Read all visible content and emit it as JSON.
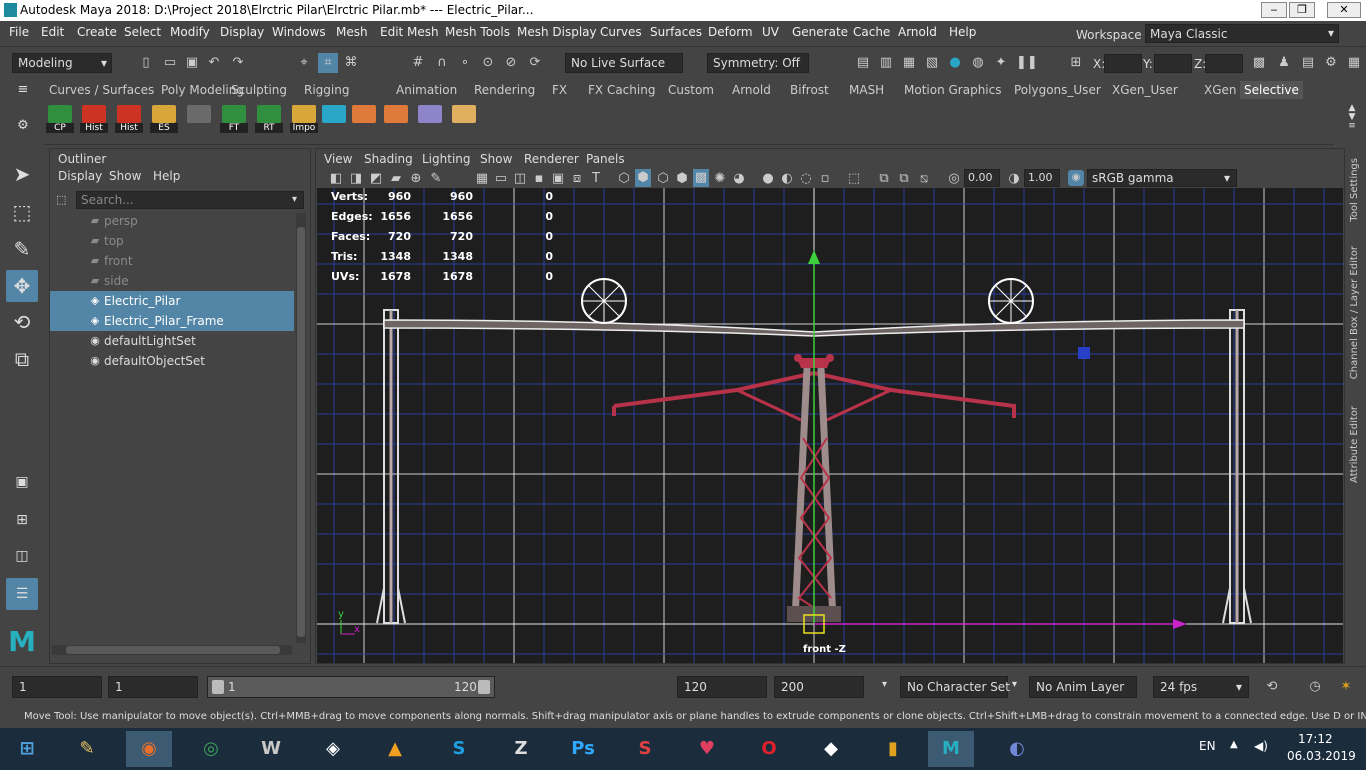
{
  "window": {
    "title": "Autodesk Maya 2018: D:\\Project 2018\\Elrctric Pilar\\Elrctric Pilar.mb*   ---   Electric_Pilar...",
    "minimize": "‒",
    "maximize": "❐",
    "close": "✕"
  },
  "menu": [
    "File",
    "Edit",
    "Create",
    "Select",
    "Modify",
    "Display",
    "Windows",
    "Mesh",
    "Edit Mesh",
    "Mesh Tools",
    "Mesh Display",
    "Curves",
    "Surfaces",
    "Deform",
    "UV",
    "Generate",
    "Cache",
    "Arnold",
    "Help"
  ],
  "workspace": {
    "label": "Workspace :",
    "value": "Maya Classic"
  },
  "status": {
    "mode": "Modeling",
    "live_surface": "No Live Surface",
    "symmetry": "Symmetry: Off",
    "x_label": "X:",
    "y_label": "Y:",
    "z_label": "Z:"
  },
  "shelf_tabs": [
    "Curves / Surfaces",
    "Poly Modeling",
    "Sculpting",
    "Rigging",
    "Animation",
    "Rendering",
    "FX",
    "FX Caching",
    "Custom",
    "Arnold",
    "Bifrost",
    "MASH",
    "Motion Graphics",
    "Polygons_User",
    "XGen_User",
    "XGen",
    "Selective"
  ],
  "shelf_active": "Selective",
  "shelf_buttons": [
    {
      "label": "CP",
      "color": "#2f8f3f"
    },
    {
      "label": "Hist",
      "color": "#cc3322"
    },
    {
      "label": "Hist",
      "color": "#cc3322"
    },
    {
      "label": "ES",
      "color": "#d9a63a"
    },
    {
      "label": "",
      "color": "#6a6a6a"
    },
    {
      "label": "FT",
      "color": "#2f8f3f"
    },
    {
      "label": "RT",
      "color": "#2f8f3f"
    },
    {
      "label": "Impo",
      "color": "#d9a63a"
    },
    {
      "label": "",
      "color": "#2aa6c9"
    },
    {
      "label": "",
      "color": "#e07a3a"
    },
    {
      "label": "",
      "color": "#e07a3a"
    },
    {
      "label": "",
      "color": "#8e84c9"
    },
    {
      "label": "",
      "color": "#e0b060"
    }
  ],
  "outliner": {
    "title": "Outliner",
    "menus": [
      "Display",
      "Show",
      "Help"
    ],
    "search_placeholder": "Search...",
    "items": [
      {
        "name": "persp",
        "icon": "camera-icon",
        "selected": false,
        "dim": true
      },
      {
        "name": "top",
        "icon": "camera-icon",
        "selected": false,
        "dim": true
      },
      {
        "name": "front",
        "icon": "camera-icon",
        "selected": false,
        "dim": true
      },
      {
        "name": "side",
        "icon": "camera-icon",
        "selected": false,
        "dim": true
      },
      {
        "name": "Electric_Pilar",
        "icon": "mesh-icon",
        "selected": true,
        "dim": false
      },
      {
        "name": "Electric_Pilar_Frame",
        "icon": "mesh-icon",
        "selected": true,
        "dim": false
      },
      {
        "name": "defaultLightSet",
        "icon": "set-icon",
        "selected": false,
        "dim": false
      },
      {
        "name": "defaultObjectSet",
        "icon": "set-icon",
        "selected": false,
        "dim": false
      }
    ]
  },
  "viewport": {
    "menus": [
      "View",
      "Shading",
      "Lighting",
      "Show",
      "Renderer",
      "Panels"
    ],
    "exposure": "0.00",
    "gamma": "1.00",
    "color_space": "sRGB gamma",
    "camera_label": "front -Z",
    "hud": [
      {
        "label": "Verts:",
        "a": "960",
        "b": "960",
        "c": "0"
      },
      {
        "label": "Edges:",
        "a": "1656",
        "b": "1656",
        "c": "0"
      },
      {
        "label": "Faces:",
        "a": "720",
        "b": "720",
        "c": "0"
      },
      {
        "label": "Tris:",
        "a": "1348",
        "b": "1348",
        "c": "0"
      },
      {
        "label": "UVs:",
        "a": "1678",
        "b": "1678",
        "c": "0"
      }
    ],
    "axis_y": "y",
    "axis_x": "x"
  },
  "side_tabs": [
    "Tool Settings",
    "Channel Box / Layer Editor",
    "Attribute Editor"
  ],
  "timeline": {
    "start": "1",
    "current": "1",
    "range_start": "1",
    "range_end": "120",
    "end": "120",
    "max": "200",
    "character_set": "No Character Set",
    "anim_layer": "No Anim Layer",
    "fps": "24 fps"
  },
  "helpline": "Move Tool: Use manipulator to move object(s). Ctrl+MMB+drag to move components along normals. Shift+drag manipulator axis or plane handles to extrude components or clone objects. Ctrl+Shift+LMB+drag to constrain movement to a connected edge. Use D or INSERT to change the pivot position a",
  "taskbar": {
    "lang": "EN",
    "time": "17:12",
    "date": "06.03.2019",
    "apps": [
      {
        "name": "start",
        "glyph": "⊞",
        "color": "#4fa3e0"
      },
      {
        "name": "paint",
        "glyph": "✎",
        "color": "#e8c060"
      },
      {
        "name": "firefox",
        "glyph": "◉",
        "color": "#e8702a"
      },
      {
        "name": "chrome",
        "glyph": "◎",
        "color": "#3da35a"
      },
      {
        "name": "world-of-tanks",
        "glyph": "W",
        "color": "#c8c8c8"
      },
      {
        "name": "epic",
        "glyph": "◈",
        "color": "#ffffff"
      },
      {
        "name": "archicad",
        "glyph": "▲",
        "color": "#f0a020"
      },
      {
        "name": "skype",
        "glyph": "S",
        "color": "#1ea0e0"
      },
      {
        "name": "zbrush",
        "glyph": "Z",
        "color": "#dddddd"
      },
      {
        "name": "photoshop",
        "glyph": "Ps",
        "color": "#31a8ff"
      },
      {
        "name": "substance",
        "glyph": "S",
        "color": "#e04040"
      },
      {
        "name": "heart-app",
        "glyph": "♥",
        "color": "#e04060"
      },
      {
        "name": "opera",
        "glyph": "O",
        "color": "#e0202a"
      },
      {
        "name": "unity",
        "glyph": "◆",
        "color": "#ffffff"
      },
      {
        "name": "equalizer",
        "glyph": "▮",
        "color": "#e0a020"
      },
      {
        "name": "maya",
        "glyph": "M",
        "color": "#27b0c0"
      },
      {
        "name": "discord",
        "glyph": "◐",
        "color": "#7289da"
      }
    ]
  }
}
